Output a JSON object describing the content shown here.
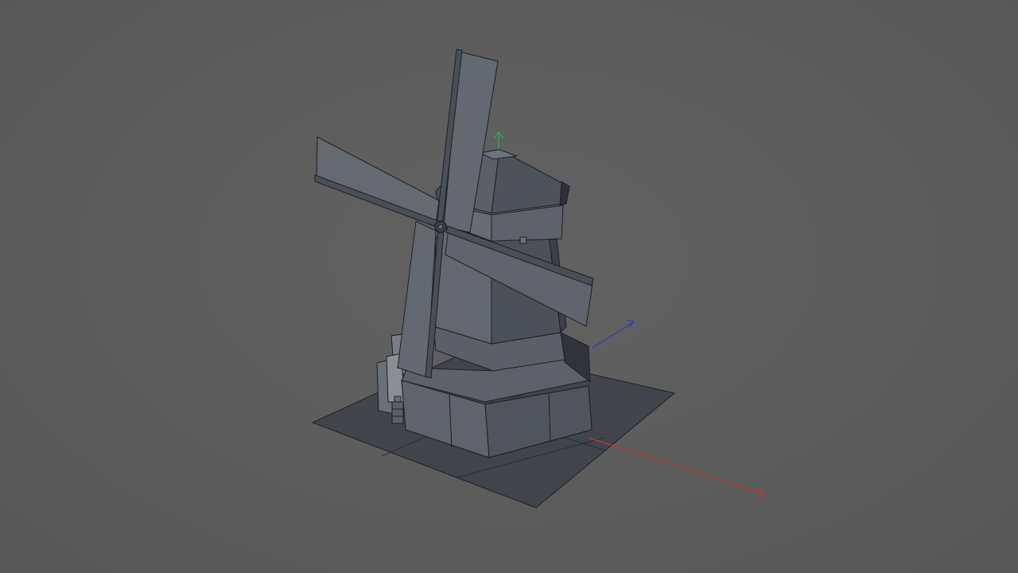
{
  "viewport": {
    "background_color": "#5b5b5b",
    "shading": "flat-shaded-with-wireframe"
  },
  "scene": {
    "object": "windmill",
    "sails_count": 4,
    "ground_plane_tiles": 4
  },
  "gizmo": {
    "x_axis_color": "#c0392b",
    "y_axis_color": "#27ae60",
    "z_axis_color": "#2f3bb0"
  },
  "materials": {
    "body_color": "#5d636c",
    "edge_color": "#1c1f24",
    "ground_color": "#40444a"
  }
}
